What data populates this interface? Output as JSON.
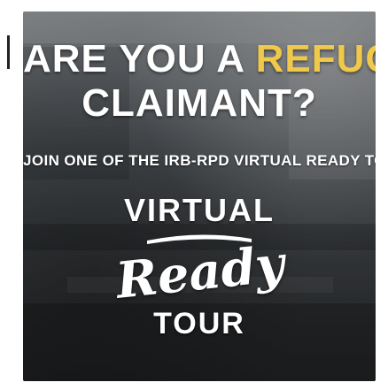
{
  "headline": {
    "line1_prefix": "ARE YOU A",
    "line1_accent": "REFUGEE",
    "line2": "CLAIMANT?"
  },
  "subheadline": "JOIN ONE OF THE IRB-RPD VIRTUAL READY TOURS",
  "logo": {
    "top_word": "VIRTUAL",
    "script_word": "Ready",
    "bottom_word": "TOUR"
  },
  "colors": {
    "accent": "#f0c84a",
    "text": "#ffffff"
  }
}
